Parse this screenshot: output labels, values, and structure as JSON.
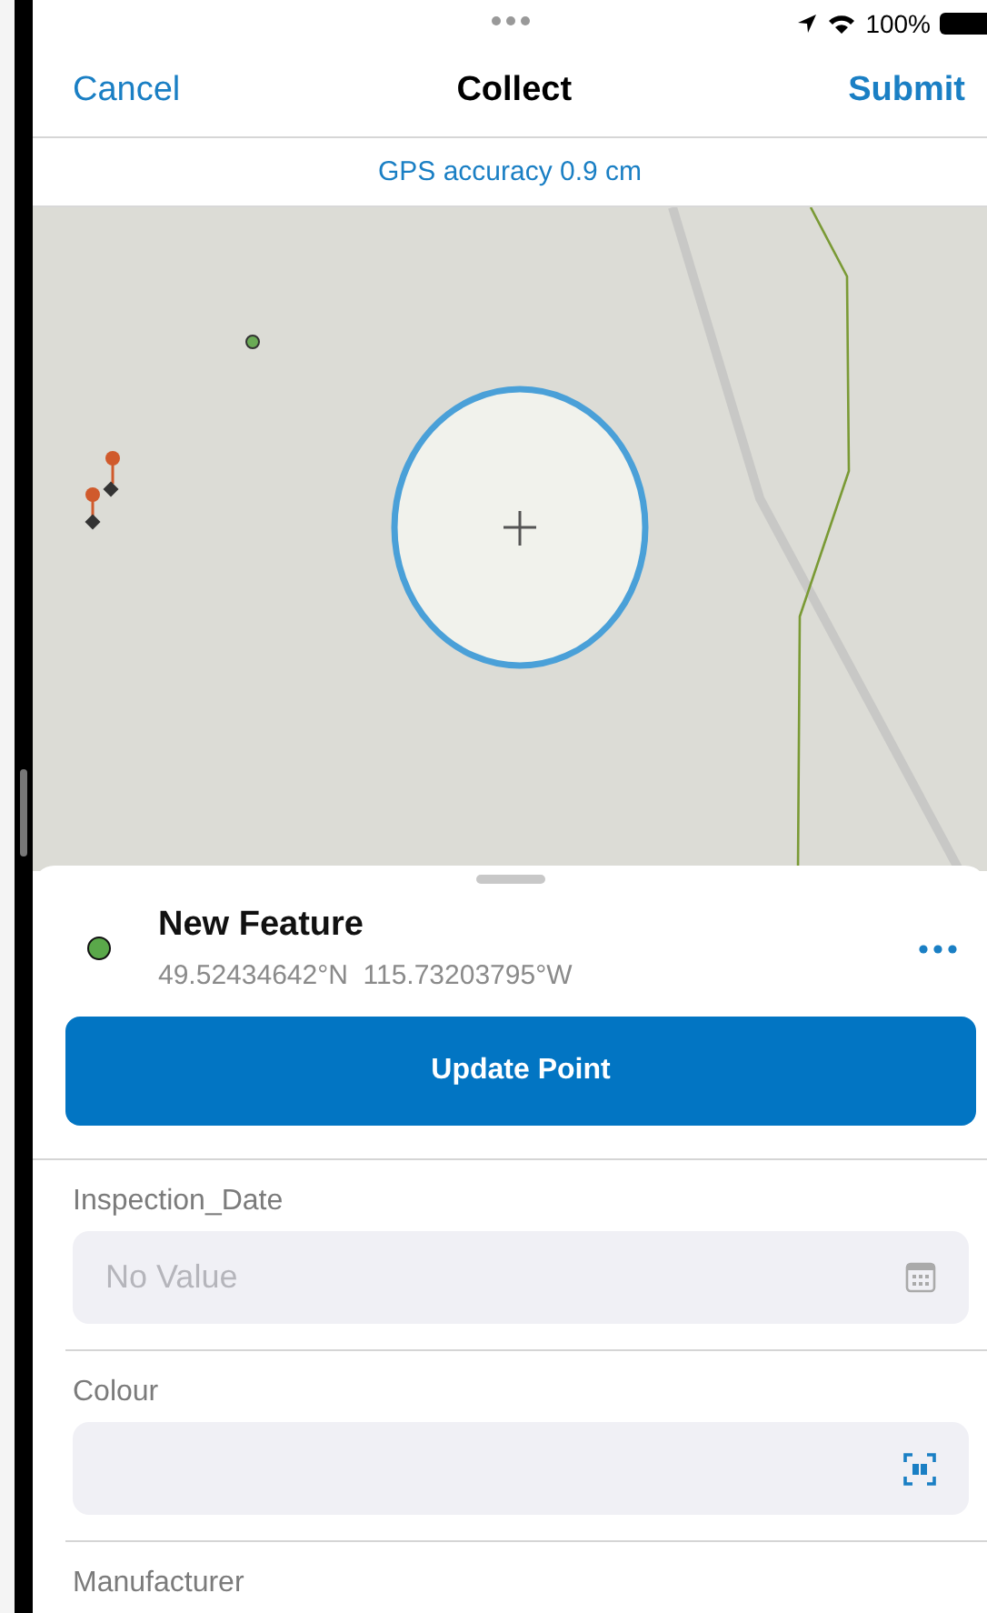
{
  "status_bar": {
    "battery": "100%"
  },
  "nav": {
    "cancel": "Cancel",
    "title": "Collect",
    "submit": "Submit"
  },
  "gps": {
    "accuracy": "GPS accuracy 0.9 cm"
  },
  "feature": {
    "title": "New Feature",
    "coordinates": "49.52434642°N  115.73203795°W",
    "color": "#5aa84a"
  },
  "update_button": "Update Point",
  "fields": [
    {
      "label": "Inspection_Date",
      "kind": "date",
      "placeholder": "No Value"
    },
    {
      "label": "Colour",
      "kind": "barcode"
    },
    {
      "label": "Manufacturer",
      "kind": "label"
    }
  ]
}
